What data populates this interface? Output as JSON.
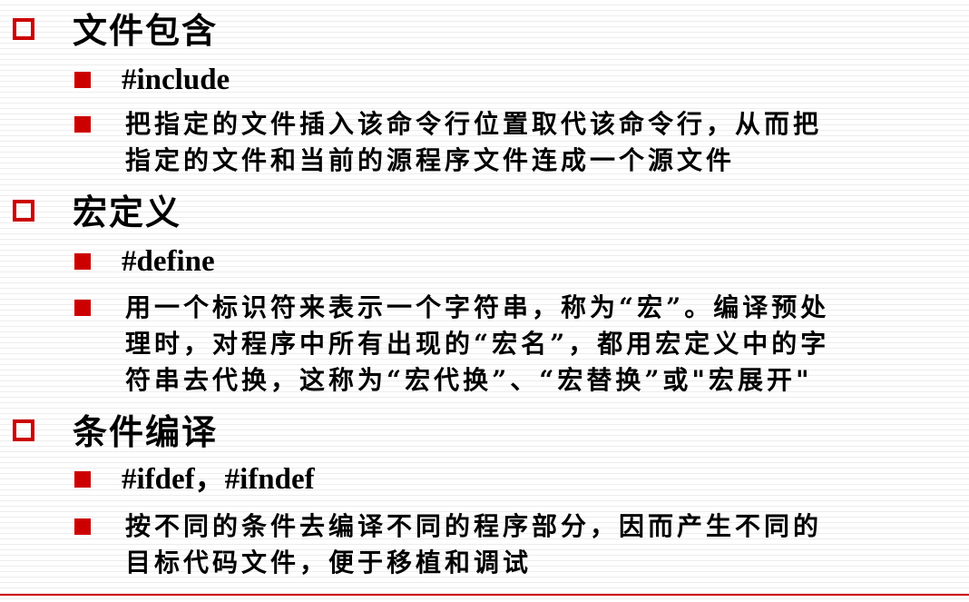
{
  "sections": [
    {
      "heading": "文件包含",
      "items": [
        {
          "lines": [
            "#include"
          ]
        },
        {
          "lines": [
            "把指定的文件插入该命令行位置取代该命令行，从而把",
            "指定的文件和当前的源程序文件连成一个源文件"
          ]
        }
      ]
    },
    {
      "heading": "宏定义",
      "items": [
        {
          "lines": [
            "#define"
          ]
        },
        {
          "lines": [
            "用一个标识符来表示一个字符串，称为“宏”。编译预处",
            "理时，对程序中所有出现的“宏名”，都用宏定义中的字",
            "符串去代换，这称为“宏代换”、“宏替换”或\"宏展开\""
          ]
        }
      ]
    },
    {
      "heading": "条件编译",
      "items": [
        {
          "lines": [
            "#ifdef，#ifndef"
          ]
        },
        {
          "lines": [
            "按不同的条件去编译不同的程序部分，因而产生不同的",
            "目标代码文件，便于移植和调试"
          ]
        }
      ]
    }
  ],
  "colors": {
    "bullet": "#cc0000",
    "rule": "#cc0000",
    "stripe": "#ededed"
  }
}
